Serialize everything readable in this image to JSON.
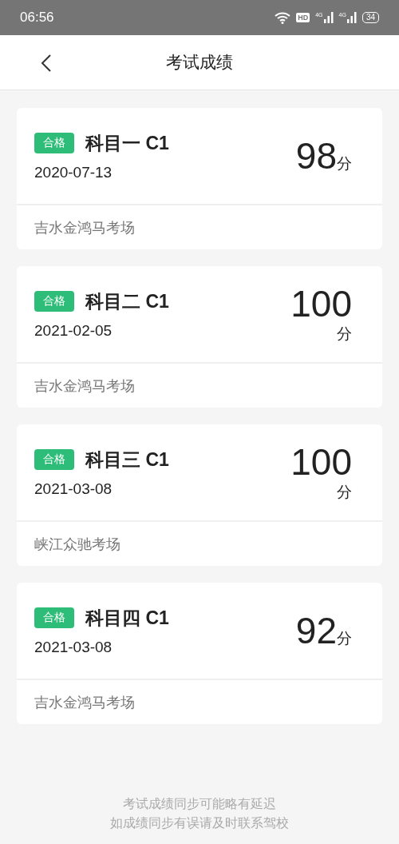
{
  "status_bar": {
    "time": "06:56",
    "hd": "HD",
    "networks": [
      "4G",
      "4G"
    ],
    "battery": "34"
  },
  "header": {
    "title": "考试成绩"
  },
  "results": [
    {
      "status": "合格",
      "subject": "科目一 C1",
      "date": "2020-07-13",
      "score": "98",
      "unit": "分",
      "kind": "inline",
      "venue": "吉水金鸿马考场"
    },
    {
      "status": "合格",
      "subject": "科目二 C1",
      "date": "2021-02-05",
      "score": "100",
      "unit": "分",
      "kind": "stacked",
      "venue": "吉水金鸿马考场"
    },
    {
      "status": "合格",
      "subject": "科目三 C1",
      "date": "2021-03-08",
      "score": "100",
      "unit": "分",
      "kind": "stacked",
      "venue": "峡江众驰考场"
    },
    {
      "status": "合格",
      "subject": "科目四 C1",
      "date": "2021-03-08",
      "score": "92",
      "unit": "分",
      "kind": "inline",
      "venue": "吉水金鸿马考场"
    }
  ],
  "footer": [
    "考试成绩同步可能略有延迟",
    "如成绩同步有误请及时联系驾校"
  ]
}
